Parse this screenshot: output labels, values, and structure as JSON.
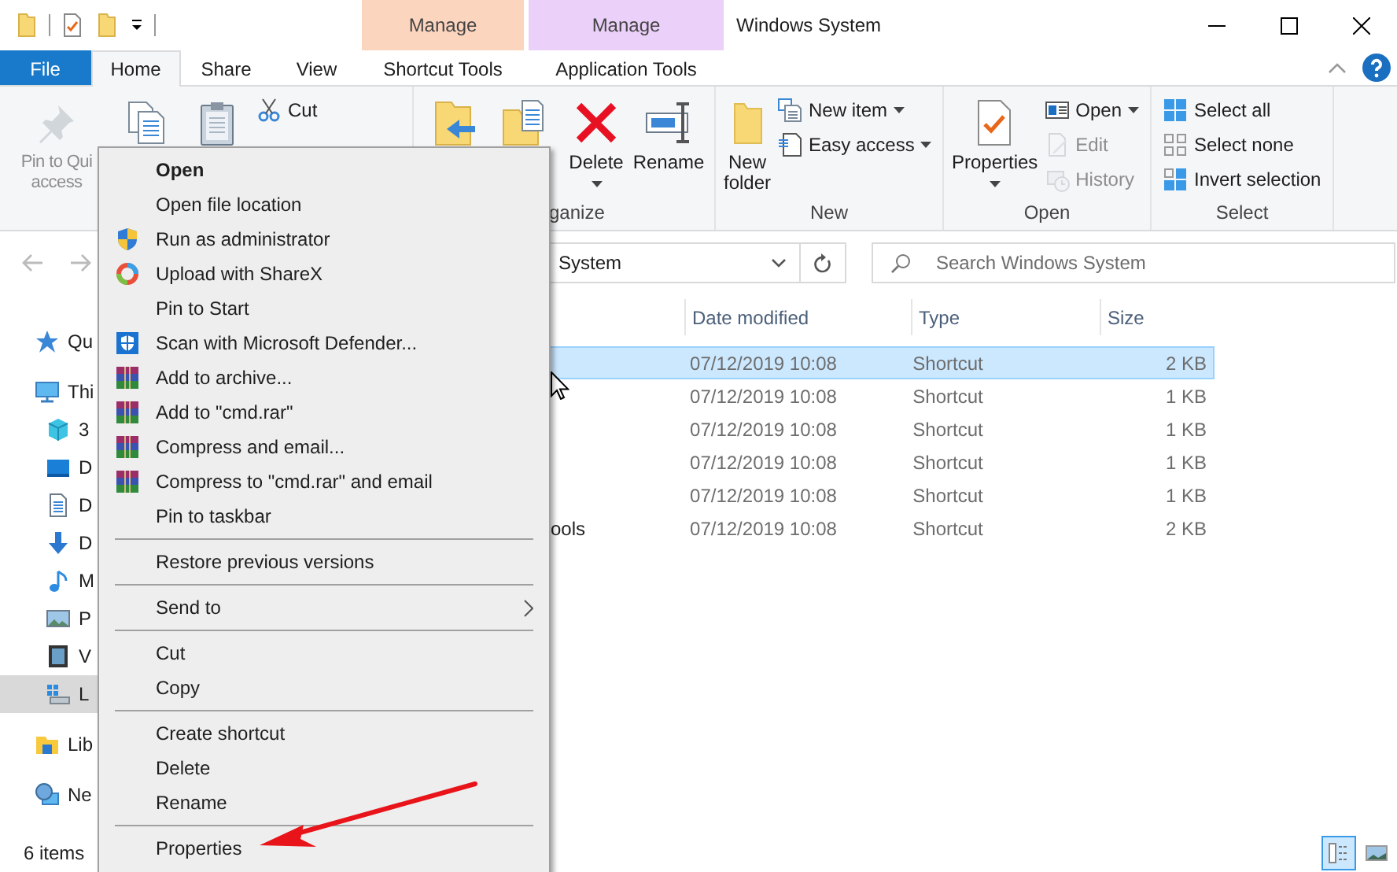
{
  "window": {
    "title": "Windows System"
  },
  "context_tabs": [
    {
      "label": "Manage",
      "color": "#fcd5bf"
    },
    {
      "label": "Manage",
      "color": "#ebd0f9"
    }
  ],
  "tabs": [
    {
      "label": "File",
      "kind": "file",
      "selected": false
    },
    {
      "label": "Home",
      "kind": "tab",
      "selected": true
    },
    {
      "label": "Share",
      "kind": "tab",
      "selected": false
    },
    {
      "label": "View",
      "kind": "tab",
      "selected": false
    },
    {
      "label": "Shortcut Tools",
      "kind": "context",
      "selected": false
    },
    {
      "label": "Application Tools",
      "kind": "context",
      "selected": false
    }
  ],
  "ribbon": [
    {
      "kind": "clipboard",
      "large": [
        {
          "kind": "pin",
          "label": "Pin to Qui access",
          "dropdown": false,
          "disabled": true
        },
        {
          "kind": "copy",
          "dropdown": false,
          "disabled": false
        },
        {
          "kind": "paste",
          "dropdown": false,
          "disabled": false
        }
      ],
      "small": [
        {
          "kind": "cut",
          "label": "Cut",
          "dropdown": false,
          "disabled": false
        }
      ]
    },
    {
      "kind": "organize",
      "label": "ganize",
      "large": [
        {
          "kind": "move_to",
          "dropdown": false,
          "disabled": false
        },
        {
          "kind": "copy_to",
          "dropdown": false,
          "disabled": false
        },
        {
          "kind": "delete",
          "label": "Delete",
          "dropdown": true,
          "disabled": false
        },
        {
          "kind": "rename",
          "label": "Rename",
          "dropdown": false,
          "disabled": false
        }
      ]
    },
    {
      "kind": "new",
      "label": "New",
      "large": [
        {
          "kind": "new_folder",
          "label": "New folder",
          "dropdown": false,
          "disabled": false
        }
      ],
      "small": [
        {
          "kind": "new_item",
          "label": "New item",
          "dropdown": true,
          "disabled": false
        },
        {
          "kind": "easy_access",
          "label": "Easy access",
          "dropdown": true,
          "disabled": false
        }
      ]
    },
    {
      "kind": "open",
      "label": "Open",
      "large": [
        {
          "kind": "properties",
          "label": "Properties",
          "dropdown": true,
          "disabled": false
        }
      ],
      "small": [
        {
          "kind": "open",
          "label": "Open",
          "dropdown": true,
          "disabled": false
        },
        {
          "kind": "edit",
          "label": "Edit",
          "dropdown": false,
          "disabled": true
        },
        {
          "kind": "history",
          "label": "History",
          "dropdown": false,
          "disabled": true
        }
      ]
    },
    {
      "kind": "select",
      "label": "Select",
      "small": [
        {
          "kind": "select_all",
          "label": "Select all",
          "dropdown": false,
          "disabled": false
        },
        {
          "kind": "select_none",
          "label": "Select none",
          "dropdown": false,
          "disabled": false
        },
        {
          "kind": "invert",
          "label": "Invert selection",
          "dropdown": false,
          "disabled": false
        }
      ]
    }
  ],
  "address": {
    "path": "System",
    "search_placeholder": "Search Windows System"
  },
  "sidebar": [
    {
      "kind": "star",
      "label": "Qu",
      "selected": false
    },
    {
      "kind": "pc",
      "label": "Thi",
      "selected": false,
      "children": [
        {
          "kind": "cube",
          "label": "3",
          "selected": false
        },
        {
          "kind": "desktop",
          "label": "D",
          "selected": false
        },
        {
          "kind": "doc",
          "label": "D",
          "selected": false
        },
        {
          "kind": "download",
          "label": "D",
          "selected": false
        },
        {
          "kind": "music",
          "label": "M",
          "selected": false
        },
        {
          "kind": "pictures",
          "label": "P",
          "selected": false
        },
        {
          "kind": "video",
          "label": "V",
          "selected": false
        },
        {
          "kind": "drive",
          "label": "L",
          "selected": true
        }
      ]
    },
    {
      "kind": "library",
      "label": "Lib",
      "selected": false
    },
    {
      "kind": "network",
      "label": "Ne",
      "selected": false
    }
  ],
  "file_list": {
    "columns": [
      "Date modified",
      "Type",
      "Size"
    ],
    "rows": [
      {
        "selected": true,
        "cells": [
          "07/12/2019 10:08",
          "Shortcut",
          "2 KB"
        ]
      },
      {
        "selected": false,
        "cells": [
          "07/12/2019 10:08",
          "Shortcut",
          "1 KB"
        ]
      },
      {
        "selected": false,
        "cells": [
          "07/12/2019 10:08",
          "Shortcut",
          "1 KB"
        ]
      },
      {
        "selected": false,
        "cells": [
          "07/12/2019 10:08",
          "Shortcut",
          "1 KB"
        ]
      },
      {
        "selected": false,
        "cells": [
          "07/12/2019 10:08",
          "Shortcut",
          "1 KB"
        ]
      },
      {
        "selected": false,
        "name": "ools",
        "cells": [
          "07/12/2019 10:08",
          "Shortcut",
          "2 KB"
        ]
      }
    ]
  },
  "context_menu": [
    {
      "kind": "default",
      "label": "Open"
    },
    {
      "kind": "plain",
      "label": "Open file location"
    },
    {
      "kind": "uac",
      "label": "Run as administrator"
    },
    {
      "kind": "sharex",
      "label": "Upload with ShareX"
    },
    {
      "kind": "plain",
      "label": "Pin to Start"
    },
    {
      "kind": "defender",
      "label": "Scan with Microsoft Defender..."
    },
    {
      "kind": "winrar",
      "label": "Add to archive..."
    },
    {
      "kind": "winrar",
      "label": "Add to \"cmd.rar\""
    },
    {
      "kind": "winrar",
      "label": "Compress and email..."
    },
    {
      "kind": "winrar",
      "label": "Compress to \"cmd.rar\" and email"
    },
    {
      "kind": "plain",
      "label": "Pin to taskbar"
    },
    {
      "kind": "separator"
    },
    {
      "kind": "plain",
      "label": "Restore previous versions"
    },
    {
      "kind": "separator"
    },
    {
      "kind": "submenu",
      "label": "Send to"
    },
    {
      "kind": "separator"
    },
    {
      "kind": "plain",
      "label": "Cut"
    },
    {
      "kind": "plain",
      "label": "Copy"
    },
    {
      "kind": "separator"
    },
    {
      "kind": "plain",
      "label": "Create shortcut"
    },
    {
      "kind": "plain",
      "label": "Delete"
    },
    {
      "kind": "plain",
      "label": "Rename"
    },
    {
      "kind": "separator"
    },
    {
      "kind": "plain",
      "label": "Properties"
    }
  ],
  "status_bar": {
    "item_count": "6 items",
    "views": [
      {
        "kind": "details",
        "selected": true
      },
      {
        "kind": "large_icons",
        "selected": false
      }
    ]
  }
}
